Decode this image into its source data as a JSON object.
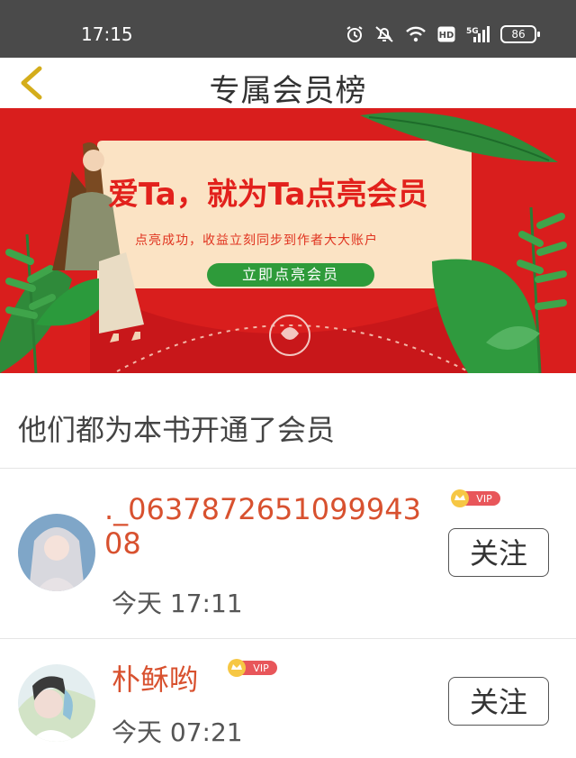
{
  "status_bar": {
    "time": "17:15",
    "battery": "86"
  },
  "nav": {
    "title": "专属会员榜"
  },
  "banner": {
    "headline": "爱Ta，就为Ta点亮会员",
    "subtitle": "点亮成功，收益立刻同步到作者大大账户",
    "cta": "立即点亮会员"
  },
  "section": {
    "title": "他们都为本书开通了会员"
  },
  "members": [
    {
      "name": "._063787265109994308",
      "badge": "VIP",
      "time": "今天 17:11",
      "follow": "关注"
    },
    {
      "name": "朴稣哟",
      "badge": "VIP",
      "time": "今天 07:21",
      "follow": "关注"
    }
  ]
}
